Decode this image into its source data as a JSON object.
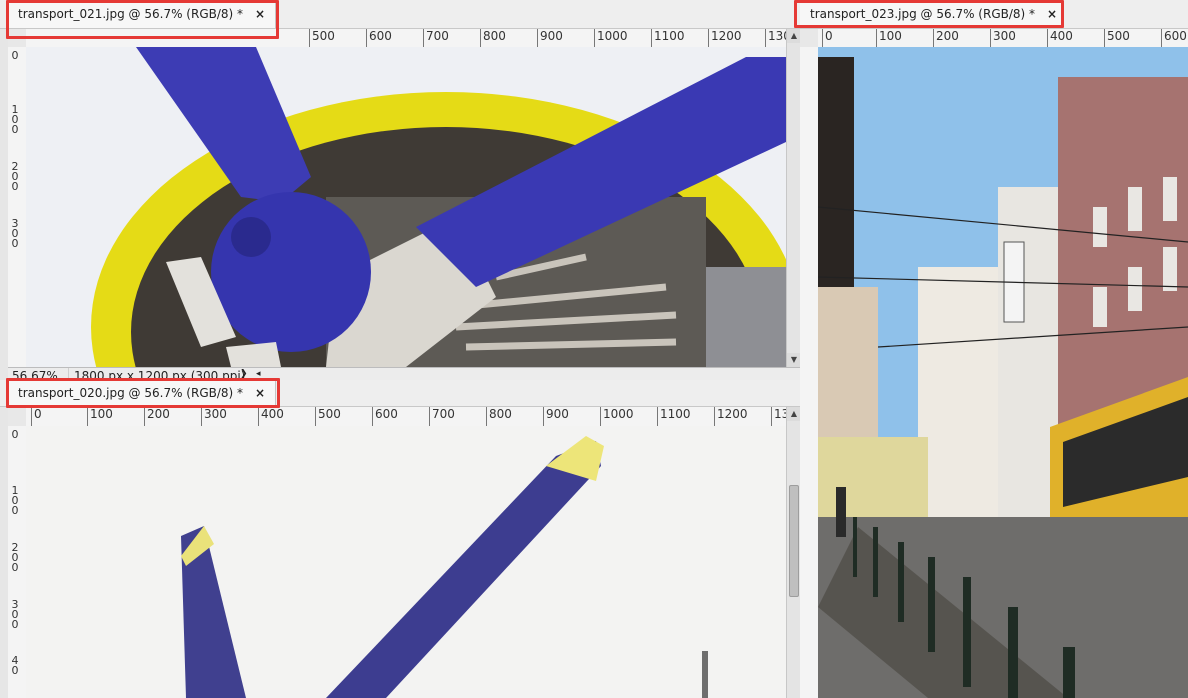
{
  "documents": {
    "top_left": {
      "tab_label": "transport_021.jpg @ 56.7% (RGB/8) *",
      "close": "×",
      "ruler_h": [
        "500",
        "600",
        "700",
        "800",
        "900",
        "1000",
        "1100",
        "1200",
        "130"
      ],
      "ruler_v": [
        "0",
        "1\n0\n0",
        "2\n0\n0",
        "3\n0\n0"
      ],
      "status_zoom": "56.67%",
      "status_info": "1800 px x 1200 px (300 ppi)",
      "status_arrow": "❯",
      "scroll_arrow_left": "◂"
    },
    "bottom_left": {
      "tab_label": "transport_020.jpg @ 56.7% (RGB/8) *",
      "close": "×",
      "ruler_h": [
        "0",
        "100",
        "200",
        "300",
        "400",
        "500",
        "600",
        "700",
        "800",
        "900",
        "1000",
        "1100",
        "1200",
        "13"
      ],
      "ruler_v": [
        "0",
        "1\n0\n0",
        "2\n0\n0",
        "3\n0\n0",
        "4\n0"
      ]
    },
    "right": {
      "tab_label": "transport_023.jpg @ 56.7% (RGB/8) *",
      "close": "×",
      "ruler_h": [
        "0",
        "100",
        "200",
        "300",
        "400",
        "500",
        "600"
      ],
      "ruler_v": []
    }
  },
  "colors": {
    "highlight": "#e53935",
    "propeller_blue": "#3a3ab8",
    "cowling_yellow": "#e8df1a",
    "sky": "#9cc8ec",
    "building_pink": "#b07a78",
    "tram_yellow": "#e3b624"
  }
}
